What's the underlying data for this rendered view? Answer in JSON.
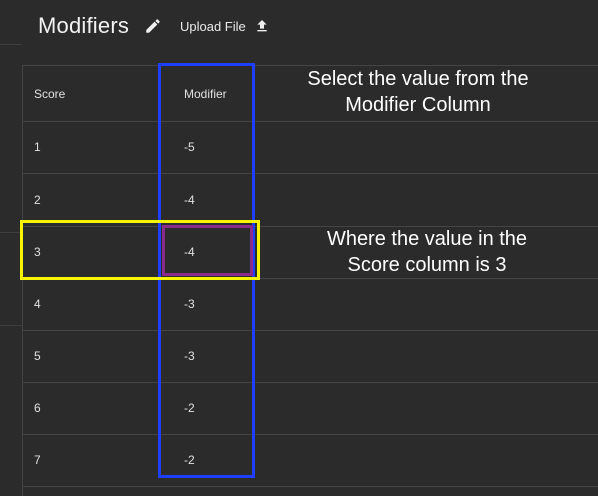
{
  "header": {
    "title": "Modifiers",
    "upload_label": "Upload File",
    "edit_icon": "pencil-icon",
    "upload_icon": "upload-icon"
  },
  "table": {
    "columns": [
      "Score",
      "Modifier"
    ],
    "rows": [
      [
        "1",
        "-5"
      ],
      [
        "2",
        "-4"
      ],
      [
        "3",
        "-4"
      ],
      [
        "4",
        "-3"
      ],
      [
        "5",
        "-3"
      ],
      [
        "6",
        "-2"
      ],
      [
        "7",
        "-2"
      ]
    ]
  },
  "annotations": {
    "modifier_note_line1": "Select the value from the",
    "modifier_note_line2": "Modifier Column",
    "score_note_line1": "Where the value in the",
    "score_note_line2": "Score column is 3"
  },
  "colors": {
    "background": "#2b2b2b",
    "highlight_blue": "#1e3fff",
    "highlight_yellow": "#f5f500",
    "highlight_purple": "#8a2b8c"
  }
}
